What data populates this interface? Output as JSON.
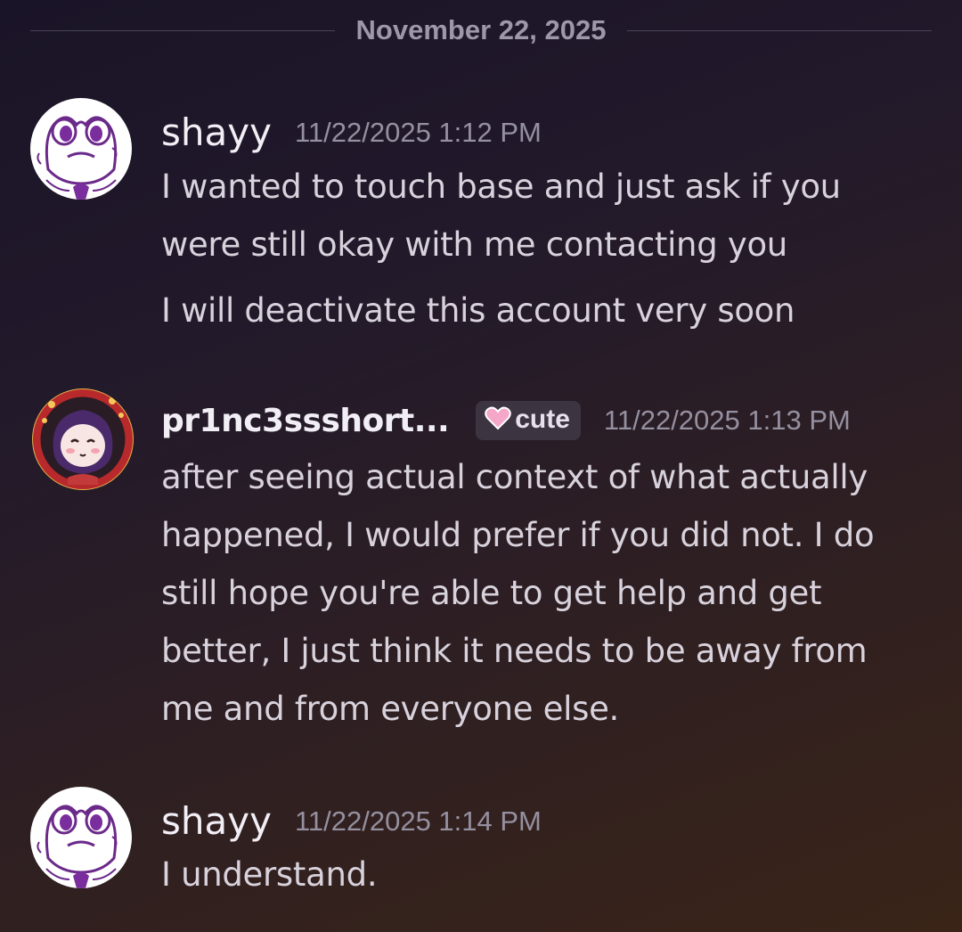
{
  "date_divider": "November 22, 2025",
  "messages": [
    {
      "username": "shayy",
      "timestamp": "11/22/2025 1:12 PM",
      "avatar": "frog-avatar",
      "lines": [
        "I wanted to touch base and just ask if you",
        "were still okay with me contacting you",
        "I will deactivate this account very soon"
      ]
    },
    {
      "username": "pr1nc3ssshort...",
      "tag_icon": "pink-heart-icon",
      "tag_label": "cute",
      "timestamp": "11/22/2025 1:13 PM",
      "avatar": "hooded-girl-avatar",
      "lines": [
        "after seeing actual context of what actually",
        "happened, I would prefer if you did not. I do",
        "still hope you're able to get help and get",
        "better, I just think it needs to be away from",
        "me and from everyone else."
      ]
    },
    {
      "username": "shayy",
      "timestamp": "11/22/2025 1:14 PM",
      "avatar": "frog-avatar",
      "lines": [
        "I understand."
      ]
    }
  ],
  "colors": {
    "username": "#f1eef5",
    "timestamp": "#9590a0",
    "message_text": "#d8d2dc",
    "tag_background": "#3c3440",
    "heart": "#f4a7c9"
  }
}
